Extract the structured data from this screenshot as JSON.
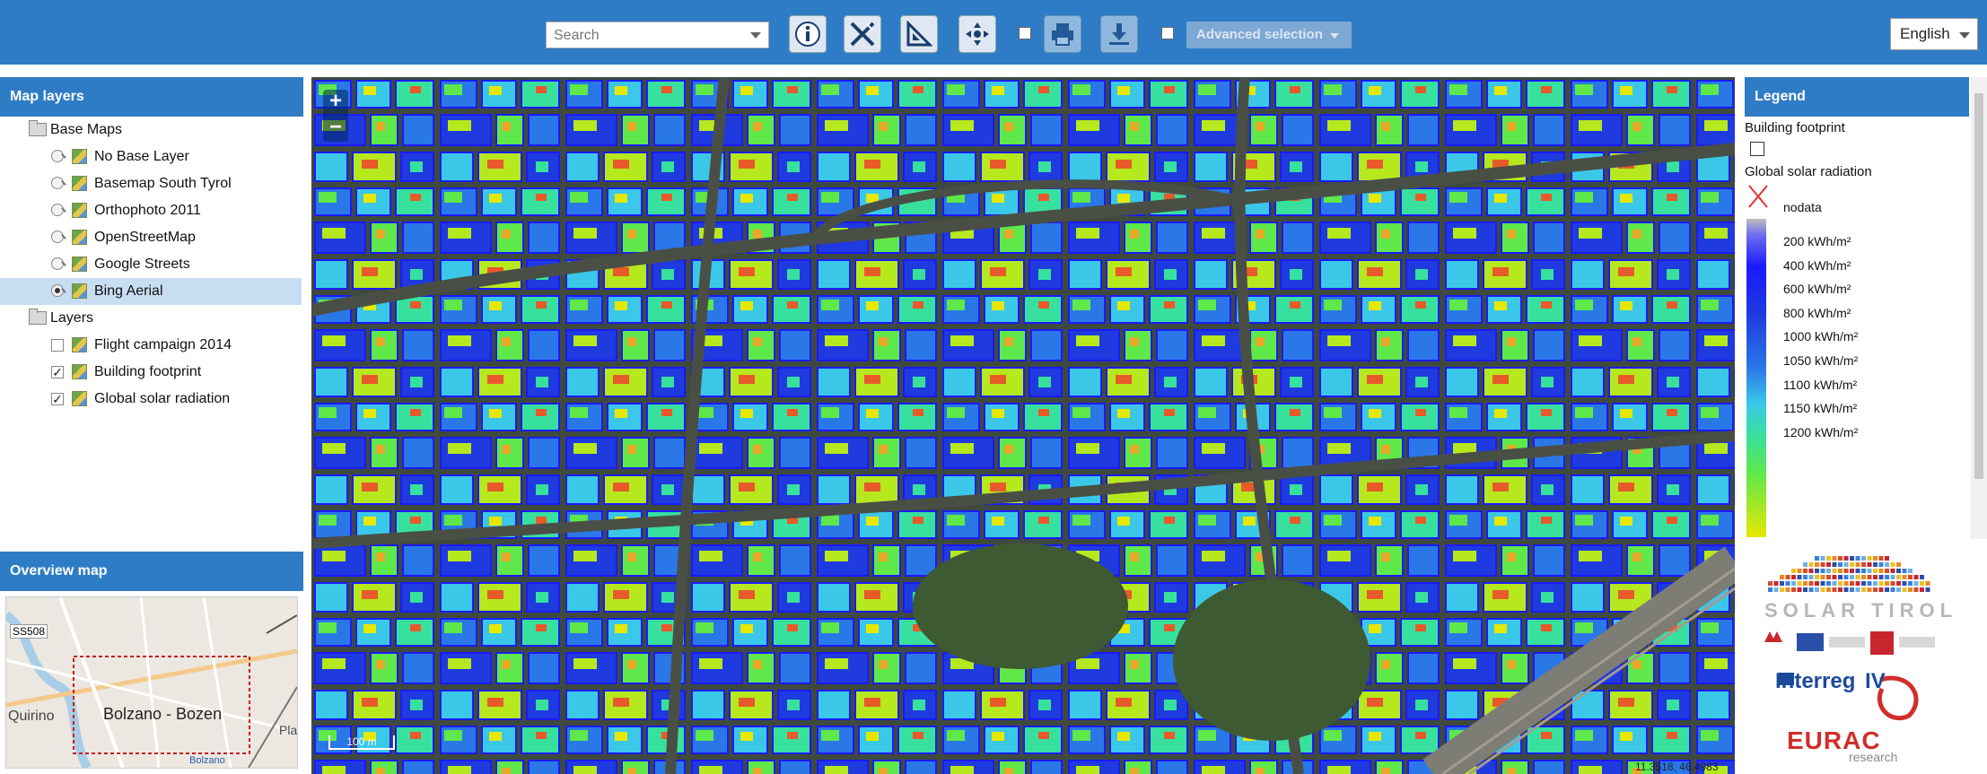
{
  "toolbar": {
    "search_placeholder": "Search",
    "advanced_label": "Advanced selection",
    "language": "English",
    "icons": [
      "info-icon",
      "measure-tools-icon",
      "ruler-icon",
      "pan-icon",
      "print-icon",
      "download-icon"
    ]
  },
  "layers_panel": {
    "title": "Map layers",
    "groups": [
      {
        "label": "Base Maps",
        "items": [
          {
            "label": "No Base Layer",
            "selected": false
          },
          {
            "label": "Basemap South Tyrol",
            "selected": false
          },
          {
            "label": "Orthophoto 2011",
            "selected": false
          },
          {
            "label": "OpenStreetMap",
            "selected": false
          },
          {
            "label": "Google Streets",
            "selected": false
          },
          {
            "label": "Bing Aerial",
            "selected": true
          }
        ]
      },
      {
        "label": "Layers",
        "items": [
          {
            "label": "Flight campaign 2014",
            "checked": false
          },
          {
            "label": "Building footprint",
            "checked": true
          },
          {
            "label": "Global solar radiation",
            "checked": true
          }
        ]
      }
    ]
  },
  "overview": {
    "title": "Overview map",
    "city_label": "Bolzano - Bozen",
    "road_label": "SS508",
    "place_label_1": "Quirino",
    "place_label_2": "Bolzano",
    "place_label_3": "Pla"
  },
  "map": {
    "zoom_in": "+",
    "zoom_out": "−",
    "scale_label": "100 m",
    "coordinates": "11.3518, 46.4983"
  },
  "legend": {
    "title": "Legend",
    "footprint_label": "Building footprint",
    "radiation_label": "Global solar radiation",
    "nodata_label": "nodata",
    "ramp_labels": [
      "200 kWh/m²",
      "400 kWh/m²",
      "600 kWh/m²",
      "800 kWh/m²",
      "1000 kWh/m²",
      "1050 kWh/m²",
      "1100 kWh/m²",
      "1150 kWh/m²",
      "1200 kWh/m²"
    ]
  },
  "logos": {
    "solar": "SOLAR TIROL",
    "interreg": "Interreg",
    "interreg_numeral": "IV",
    "eurac": "EURAC",
    "eurac_sub": "research"
  },
  "colors": {
    "header_blue": "#2f7cc6",
    "selection": "#c7ddf2"
  }
}
